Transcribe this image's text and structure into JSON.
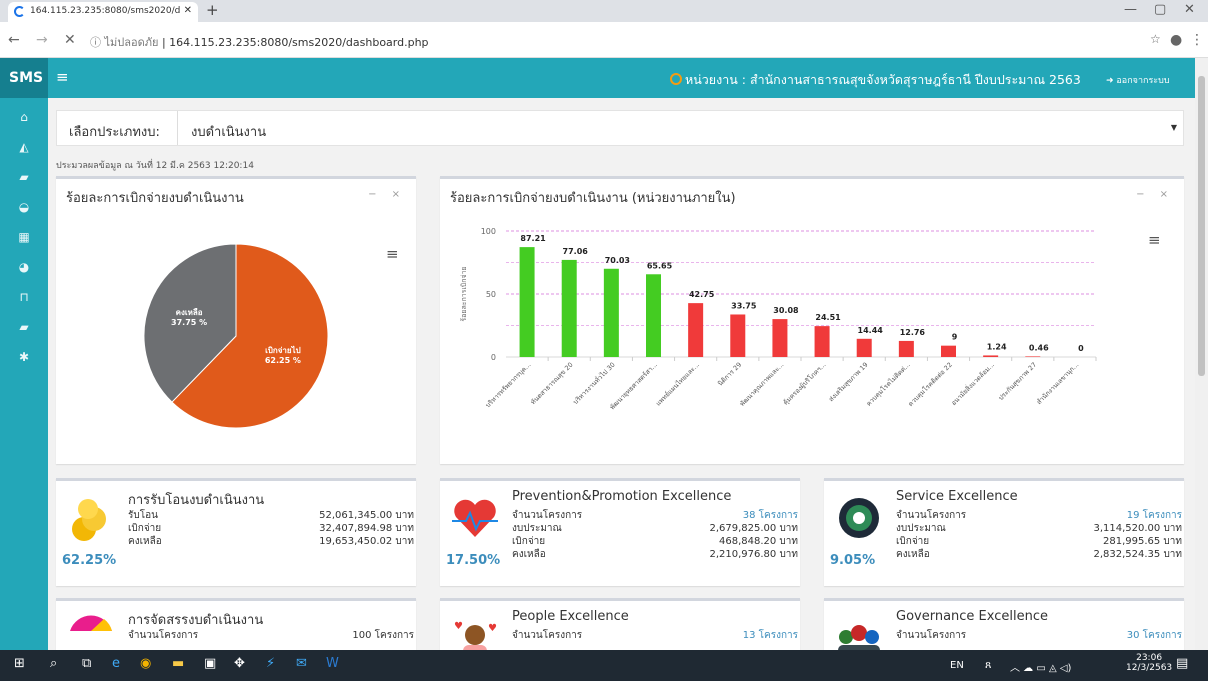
{
  "browser": {
    "tab_title": "164.115.23.235:8080/sms2020/d",
    "url_prefix": "ไม่ปลอดภัย",
    "url": "164.115.23.235:8080/sms2020/dashboard.php"
  },
  "app": {
    "logo": "SMS",
    "unit_title": "หน่วยงาน : สำนักงานสาธารณสุขจังหวัดสุราษฎร์ธานี ปีงบประมาณ 2563",
    "logout": "ออกจากระบบ"
  },
  "selector": {
    "label": "เลือกประเภทงบ:",
    "value": "งบดำเนินงาน"
  },
  "updated": "ประมวลผลข้อมูล ณ วันที่ 12 มี.ค 2563 12:20:14",
  "panel1": {
    "title": "ร้อยละการเบิกจ่ายงบดำเนินงาน",
    "tools": "− ×"
  },
  "panel2": {
    "title": "ร้อยละการเบิกจ่ายงบดำเนินงาน (หน่วยงานภายใน)",
    "tools": "− ×"
  },
  "chart_data": [
    {
      "type": "pie",
      "slices": [
        {
          "label": "เบิกจ่ายไป",
          "value": 62.25,
          "display": "62.25 %",
          "color": "#e05a1b"
        },
        {
          "label": "คงเหลือ",
          "value": 37.75,
          "display": "37.75 %",
          "color": "#6d6f72"
        }
      ]
    },
    {
      "type": "bar",
      "ylabel": "ร้อยละการเบิกจ่าย",
      "ylim": [
        0,
        100
      ],
      "yticks": [
        0,
        50,
        100
      ],
      "categories": [
        "บริหารทรัพยากรบุค...",
        "ทันตสาธารณสุข 20",
        "บริหารงานทั่วไป 30",
        "พัฒนายุทธศาสตร์สา...",
        "แพทย์แผนไทยและ...",
        "นิติการ 29",
        "พัฒนาคุณภาพและ...",
        "คุ้มครองผู้บริโภคฯ...",
        "ส่งเสริมสุขภาพ 19",
        "ควบคุมโรคไม่ติดต่...",
        "ควบคุมโรคติดต่อ 22",
        "อนามัยสิ่งแวดล้อม...",
        "ประกันสุขภาพ 27",
        "สำนักงานเลขานุก..."
      ],
      "values": [
        87.21,
        77.06,
        70.03,
        65.65,
        42.75,
        33.75,
        30.08,
        24.51,
        14.44,
        12.76,
        9,
        1.24,
        0.46,
        0
      ],
      "value_labels": [
        "87.21",
        "77.06",
        "70.03",
        "65.65",
        "42.75",
        "33.75",
        "30.08",
        "24.51",
        "14.44",
        "12.76",
        "9",
        "1.24",
        "0.46",
        "0"
      ],
      "colors": [
        "#44cc22",
        "#44cc22",
        "#44cc22",
        "#44cc22",
        "#f03a3a",
        "#f03a3a",
        "#f03a3a",
        "#f03a3a",
        "#f03a3a",
        "#f03a3a",
        "#f03a3a",
        "#f03a3a",
        "#f03a3a",
        "#f03a3a"
      ]
    }
  ],
  "cards": [
    {
      "title": "การรับโอนงบดำเนินงาน",
      "pct": "62.25%",
      "rows": [
        {
          "l": "รับโอน",
          "v": "52,061,345.00 บาท"
        },
        {
          "l": "เบิกจ่าย",
          "v": "32,407,894.98 บาท"
        },
        {
          "l": "คงเหลือ",
          "v": "19,653,450.02 บาท"
        }
      ]
    },
    {
      "title": "Prevention&Promotion Excellence",
      "pct": "17.50%",
      "rows": [
        {
          "l": "จำนวนโครงการ",
          "v": "38 โครงการ",
          "link": true
        },
        {
          "l": "งบประมาณ",
          "v": "2,679,825.00 บาท"
        },
        {
          "l": "เบิกจ่าย",
          "v": "468,848.20 บาท"
        },
        {
          "l": "คงเหลือ",
          "v": "2,210,976.80 บาท"
        }
      ]
    },
    {
      "title": "Service Excellence",
      "pct": "9.05%",
      "rows": [
        {
          "l": "จำนวนโครงการ",
          "v": "19 โครงการ",
          "link": true
        },
        {
          "l": "งบประมาณ",
          "v": "3,114,520.00 บาท"
        },
        {
          "l": "เบิกจ่าย",
          "v": "281,995.65 บาท"
        },
        {
          "l": "คงเหลือ",
          "v": "2,832,524.35 บาท"
        }
      ]
    },
    {
      "title": "การจัดสรรงบดำเนินงาน",
      "rows": [
        {
          "l": "จำนวนโครงการ",
          "v": "100 โครงการ"
        }
      ]
    },
    {
      "title": "People Excellence",
      "rows": [
        {
          "l": "จำนวนโครงการ",
          "v": "13 โครงการ",
          "link": true
        }
      ]
    },
    {
      "title": "Governance Excellence",
      "rows": [
        {
          "l": "จำนวนโครงการ",
          "v": "30 โครงการ",
          "link": true
        }
      ]
    }
  ],
  "taskbar": {
    "lang": "EN",
    "time": "23:06",
    "date": "12/3/2563"
  }
}
